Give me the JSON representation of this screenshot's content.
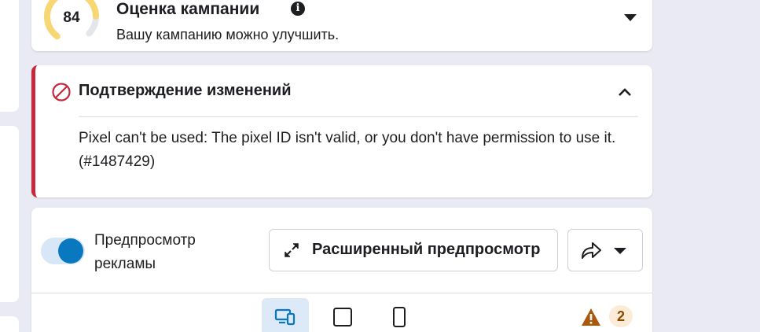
{
  "score": {
    "value": "84",
    "title": "Оценка кампании",
    "subtitle": "Вашу кампанию можно улучшить.",
    "gauge_fraction": 0.84,
    "gauge_color": "#f7d774",
    "gauge_track_color": "#e4e6eb"
  },
  "error": {
    "title": "Подтверждение изменений",
    "message": "Pixel can't be used: The pixel ID isn't valid, or you don't have permission to use it. (#1487429)",
    "accent_color": "#c8283b"
  },
  "preview": {
    "toggle_label": "Предпросмотр рекламы",
    "toggle_on": true,
    "expand_label": "Расширенный предпросмотр",
    "warning_count": "2",
    "accent_color": "#0a78be"
  },
  "icons": {
    "info": "info-icon",
    "error": "ban-icon",
    "expand": "expand-arrows-icon",
    "share": "share-arrow-icon",
    "warning": "warning-icon"
  }
}
